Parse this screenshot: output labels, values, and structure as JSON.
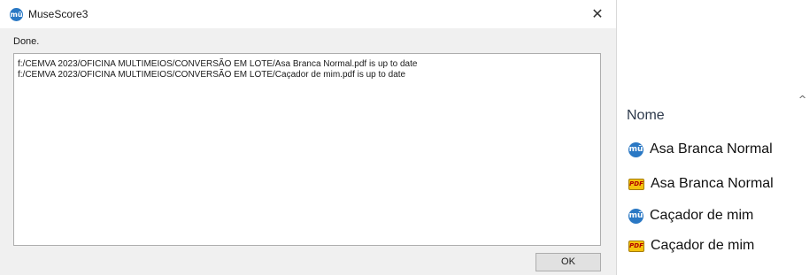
{
  "dialog": {
    "title": "MuseScore3",
    "app_icon_glyph": "mū",
    "close_glyph": "✕",
    "status": "Done.",
    "log_lines": [
      "f:/CEMVA 2023/OFICINA MULTIMEIOS/CONVERSÃO EM LOTE/Asa Branca Normal.pdf is up to date",
      "f:/CEMVA 2023/OFICINA MULTIMEIOS/CONVERSÃO EM LOTE/Caçador de mim.pdf is up to date"
    ],
    "ok_label": "OK"
  },
  "explorer": {
    "sort_indicator": "^",
    "column_header": "Nome",
    "files": [
      {
        "icon": "musescore-file-icon",
        "icon_glyph": "mū",
        "name": "Asa Branca Normal"
      },
      {
        "icon": "pdf-file-icon",
        "icon_glyph": "PDF",
        "name": "Asa Branca Normal"
      },
      {
        "icon": "musescore-file-icon",
        "icon_glyph": "mū",
        "name": "Caçador de mim"
      },
      {
        "icon": "pdf-file-icon",
        "icon_glyph": "PDF",
        "name": "Caçador de mim"
      }
    ]
  },
  "colors": {
    "musescore_blue": "#2a78c4",
    "pdf_yellow": "#f4c20d",
    "dialog_bg": "#f0f0f0"
  }
}
